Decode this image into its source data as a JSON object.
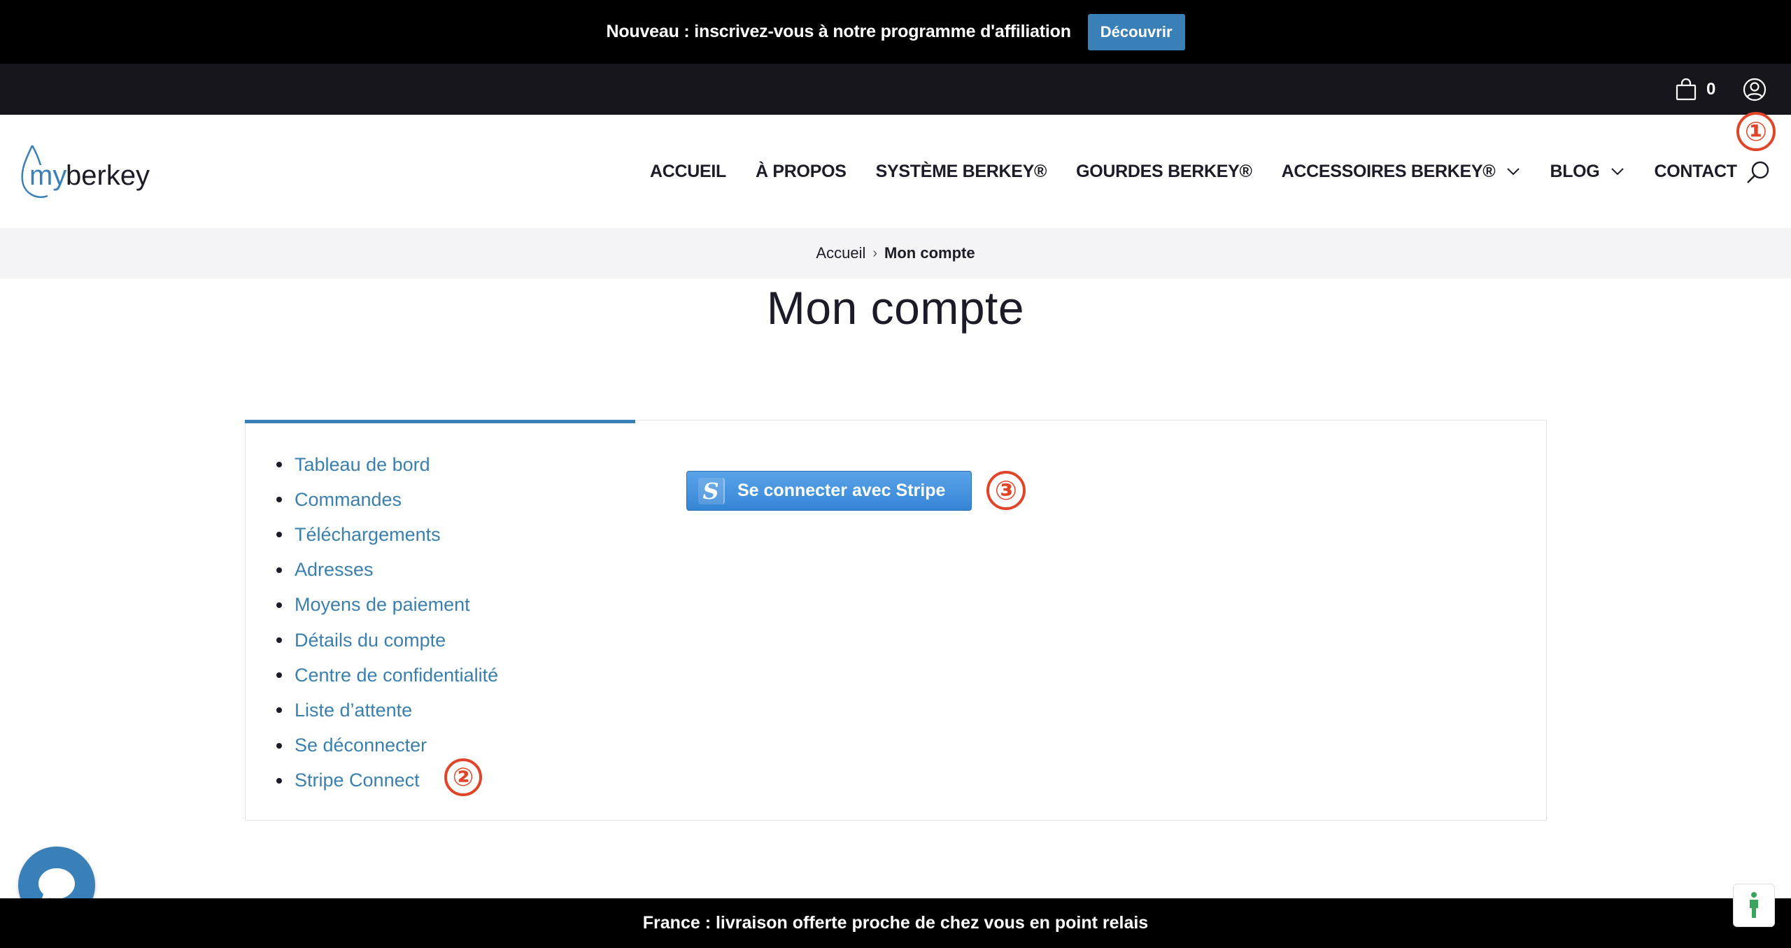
{
  "announcement": {
    "text": "Nouveau : inscrivez-vous à notre programme d'affiliation",
    "button_label": "Découvrir"
  },
  "utility": {
    "cart_count": "0",
    "icons": [
      "cart-icon",
      "user-icon"
    ]
  },
  "header": {
    "logo_text": "myberkey",
    "nav": [
      {
        "label": "ACCUEIL"
      },
      {
        "label": "À PROPOS"
      },
      {
        "label": "SYSTÈME BERKEY®"
      },
      {
        "label": "GOURDES BERKEY®"
      },
      {
        "label": "ACCESSOIRES BERKEY®"
      },
      {
        "label": "BLOG"
      },
      {
        "label": "CONTACT"
      }
    ]
  },
  "breadcrumb": {
    "home": "Accueil",
    "separator": "›",
    "current": "Mon compte"
  },
  "page_title": "Mon compte",
  "account_menu": [
    "Tableau de bord",
    "Commandes",
    "Téléchargements",
    "Adresses",
    "Moyens de paiement",
    "Détails du compte",
    "Centre de confidentialité",
    "Liste d’attente",
    "Se déconnecter",
    "Stripe Connect"
  ],
  "stripe_button": {
    "icon_letter": "S",
    "label": "Se connecter avec Stripe"
  },
  "annotations": {
    "one": "①",
    "two": "②",
    "three": "③"
  },
  "footer": {
    "text": "France : livraison offerte proche de chez vous en point relais"
  },
  "colors": {
    "accent": "#3a80b8",
    "link": "#3b7fae",
    "annotation": "#e0452a",
    "dark": "#16161c"
  }
}
